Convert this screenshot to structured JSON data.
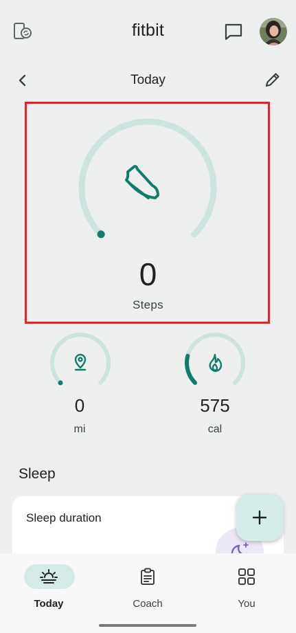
{
  "app_bar": {
    "title": "fitbit",
    "icons": {
      "devices": "devices-sync-icon",
      "messages": "chat-bubble-icon",
      "profile": "avatar"
    }
  },
  "date_nav": {
    "label": "Today",
    "icons": {
      "back": "chevron-left-icon",
      "edit": "pencil-icon"
    }
  },
  "steps": {
    "value": "0",
    "label": "Steps",
    "progress": 0,
    "icon": "shoe-icon"
  },
  "distance": {
    "value": "0",
    "unit": "mi",
    "progress": 0,
    "icon": "location-pin-icon"
  },
  "calories": {
    "value": "575",
    "unit": "cal",
    "progress": 0.22,
    "icon": "flame-icon"
  },
  "sleep": {
    "section_title": "Sleep",
    "card_title": "Sleep duration",
    "icon": "moon-stars-icon"
  },
  "fab": {
    "icon": "plus-icon"
  },
  "bottom_nav": {
    "items": [
      {
        "label": "Today",
        "icon": "sunrise-icon",
        "active": true
      },
      {
        "label": "Coach",
        "icon": "clipboard-icon",
        "active": false
      },
      {
        "label": "You",
        "icon": "grid-icon",
        "active": false
      }
    ]
  },
  "colors": {
    "accent": "#0f7d6e",
    "ring_track": "#cde3df",
    "highlight": "#d62b35",
    "background": "#eef0ef"
  }
}
